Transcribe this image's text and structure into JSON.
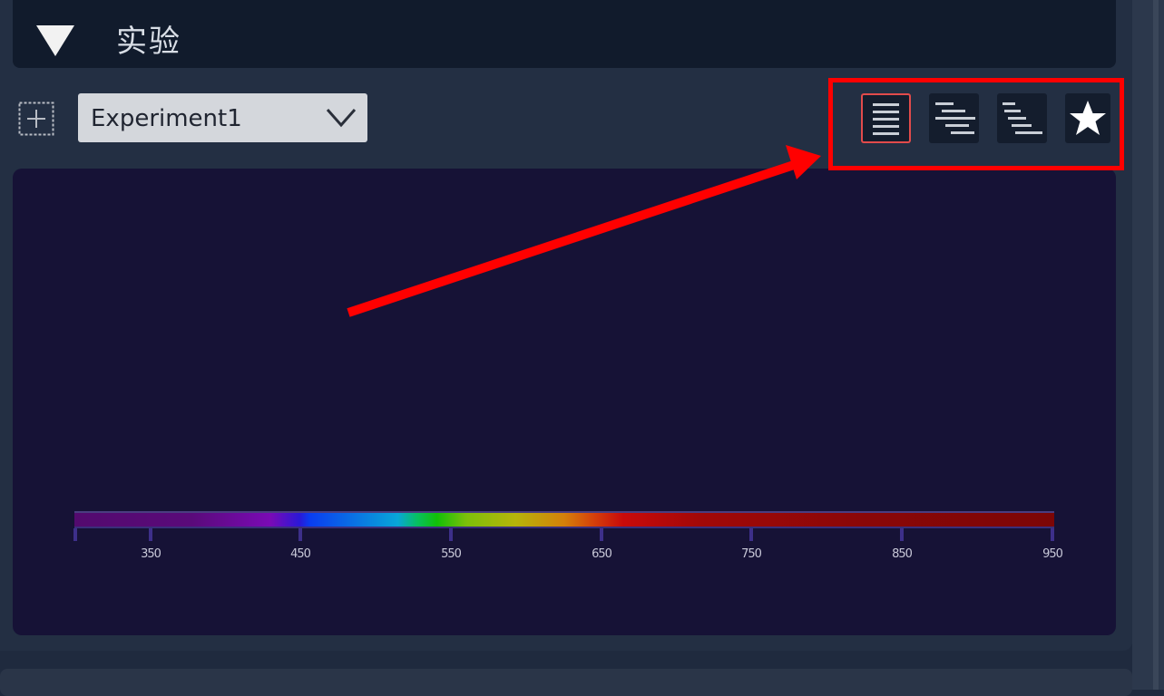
{
  "section": {
    "title": "实验",
    "collapse_icon": "triangle-down-icon"
  },
  "toolbar": {
    "add_icon": "plus-square-icon",
    "experiment_select": {
      "value": "Experiment1",
      "chevron_icon": "chevron-down-icon"
    },
    "buttons": [
      {
        "icon": "align-center-icon",
        "active": true
      },
      {
        "icon": "align-center-staggered-icon",
        "active": false
      },
      {
        "icon": "align-left-staggered-icon",
        "active": false
      },
      {
        "icon": "star-icon",
        "active": false
      }
    ]
  },
  "spectrum": {
    "ticks": [
      "350",
      "450",
      "550",
      "650",
      "750",
      "850",
      "950"
    ]
  },
  "annotation": {
    "highlight_color": "#ff0000"
  }
}
